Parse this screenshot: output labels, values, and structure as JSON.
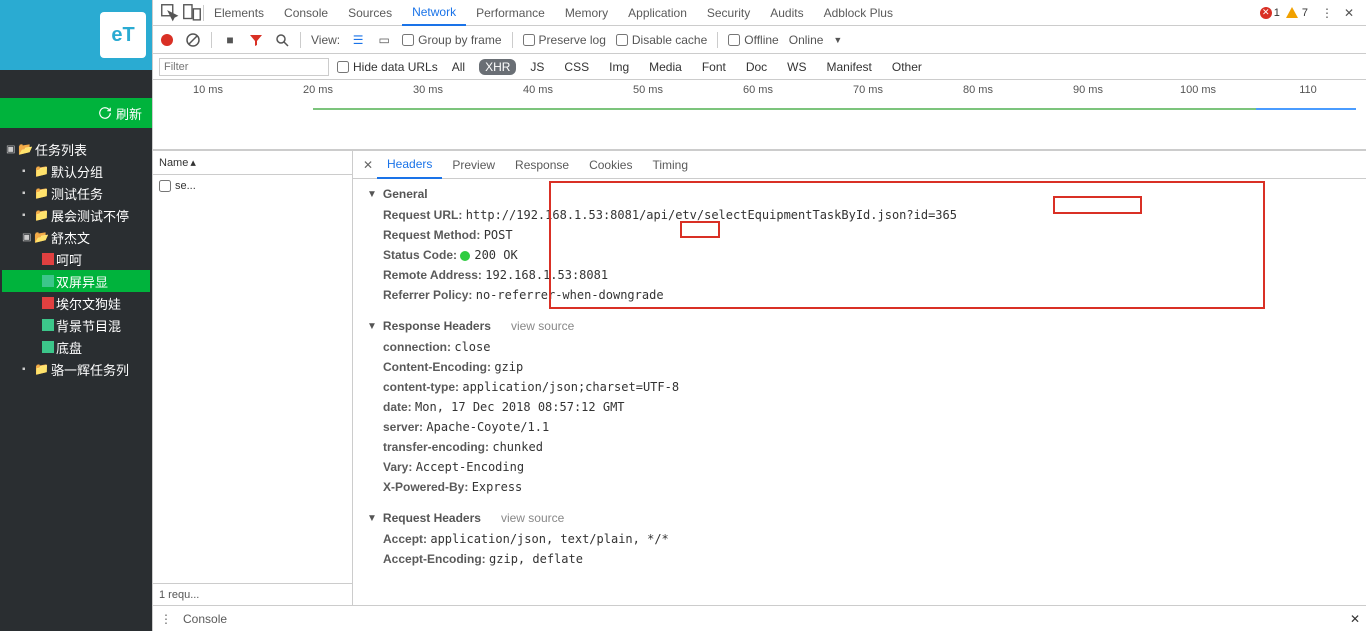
{
  "app": {
    "logo_text": "eT",
    "refresh": "刷新"
  },
  "tree": {
    "root": "任务列表",
    "n1": "默认分组",
    "n2": "测试任务",
    "n3": "展会测试不停",
    "n4": "舒杰文",
    "n4_1": "呵呵",
    "n4_2": "双屏异显",
    "n4_3": "埃尔文狗娃",
    "n4_4": "背景节目混",
    "n4_5": "底盘",
    "n5": "骆一辉任务列"
  },
  "tabs": {
    "elements": "Elements",
    "console": "Console",
    "sources": "Sources",
    "network": "Network",
    "performance": "Performance",
    "memory": "Memory",
    "application": "Application",
    "security": "Security",
    "audits": "Audits",
    "adblock": "Adblock Plus"
  },
  "errors": {
    "err": "1",
    "warn": "7"
  },
  "toolbar": {
    "view": "View:",
    "group": "Group by frame",
    "preserve": "Preserve log",
    "disable": "Disable cache",
    "offline": "Offline",
    "online": "Online"
  },
  "filter": {
    "placeholder": "Filter",
    "hide": "Hide data URLs",
    "all": "All",
    "xhr": "XHR",
    "js": "JS",
    "css": "CSS",
    "img": "Img",
    "media": "Media",
    "font": "Font",
    "doc": "Doc",
    "ws": "WS",
    "manifest": "Manifest",
    "other": "Other"
  },
  "timeline": [
    "10 ms",
    "20 ms",
    "30 ms",
    "40 ms",
    "50 ms",
    "60 ms",
    "70 ms",
    "80 ms",
    "90 ms",
    "100 ms",
    "110"
  ],
  "reqlist": {
    "col": "Name",
    "item": "se...",
    "footer": "1 requ..."
  },
  "dtabs": {
    "headers": "Headers",
    "preview": "Preview",
    "response": "Response",
    "cookies": "Cookies",
    "timing": "Timing"
  },
  "sections": {
    "general": "General",
    "response": "Response Headers",
    "request": "Request Headers",
    "viewsource": "view source"
  },
  "general": {
    "url_k": "Request URL:",
    "url_v": "http://192.168.1.53:8081/api/etv/selectEquipmentTaskById.json?id=365",
    "method_k": "Request Method:",
    "method_v": "POST",
    "status_k": "Status Code:",
    "status_v": "200 OK",
    "remote_k": "Remote Address:",
    "remote_v": "192.168.1.53:8081",
    "referrer_k": "Referrer Policy:",
    "referrer_v": "no-referrer-when-downgrade"
  },
  "resp": {
    "conn_k": "connection:",
    "conn_v": "close",
    "ce_k": "Content-Encoding:",
    "ce_v": "gzip",
    "ct_k": "content-type:",
    "ct_v": "application/json;charset=UTF-8",
    "date_k": "date:",
    "date_v": "Mon, 17 Dec 2018 08:57:12 GMT",
    "server_k": "server:",
    "server_v": "Apache-Coyote/1.1",
    "te_k": "transfer-encoding:",
    "te_v": "chunked",
    "vary_k": "Vary:",
    "vary_v": "Accept-Encoding",
    "xp_k": "X-Powered-By:",
    "xp_v": "Express"
  },
  "reqh": {
    "accept_k": "Accept:",
    "accept_v": "application/json, text/plain, */*",
    "ae_k": "Accept-Encoding:",
    "ae_v": "gzip, deflate"
  },
  "drawer": {
    "console": "Console"
  }
}
